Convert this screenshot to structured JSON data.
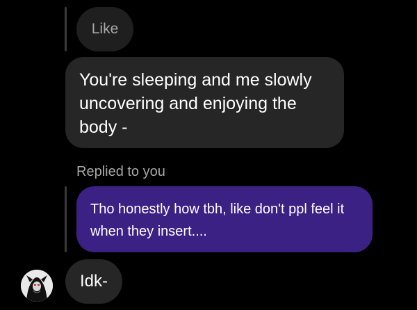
{
  "chat": {
    "like_bubble": {
      "text": "Like"
    },
    "incoming_message": {
      "text": "You're sleeping and me slowly uncovering and enjoying the body -"
    },
    "reply_context": {
      "label": "Replied to you"
    },
    "quoted_message": {
      "text": "Tho honestly how tbh, like don't ppl feel it when they insert...."
    },
    "latest_message": {
      "text": "Idk-"
    },
    "sender": {
      "avatar_icon": "user-avatar-icon"
    }
  },
  "colors": {
    "background": "#000000",
    "incoming_bubble": "#262626",
    "quoted_bubble": "#3b2184",
    "muted_text": "#a8a8a8",
    "reply_bar": "#3a3a3c"
  }
}
